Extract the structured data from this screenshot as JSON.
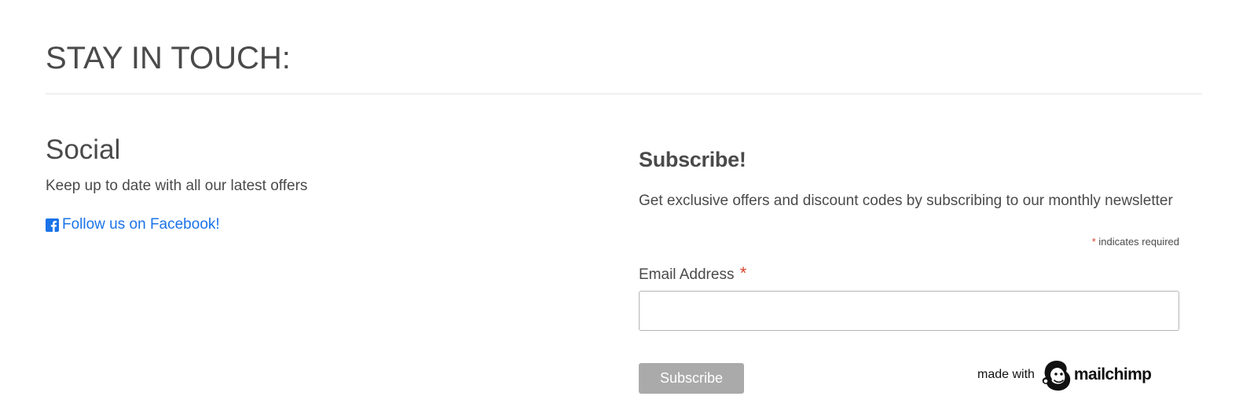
{
  "section": {
    "heading": "STAY IN TOUCH:"
  },
  "social": {
    "title": "Social",
    "description": "Keep up to date with all our latest offers",
    "facebook_link": "Follow us on Facebook!",
    "facebook_icon": "facebook-square-icon",
    "link_color": "#1a73e8"
  },
  "subscribe": {
    "title": "Subscribe!",
    "description": "Get exclusive offers and discount codes by subscribing to our monthly newsletter",
    "required_marker": "*",
    "required_note": "indicates required",
    "email_label": "Email Address",
    "email_value": "",
    "button_label": "Subscribe",
    "button_color": "#aaaaaa",
    "asterisk_color": "#d9442c"
  },
  "badge": {
    "made_with": "made with",
    "brand": "mailchimp",
    "brand_icon": "mailchimp-freddie-icon"
  }
}
